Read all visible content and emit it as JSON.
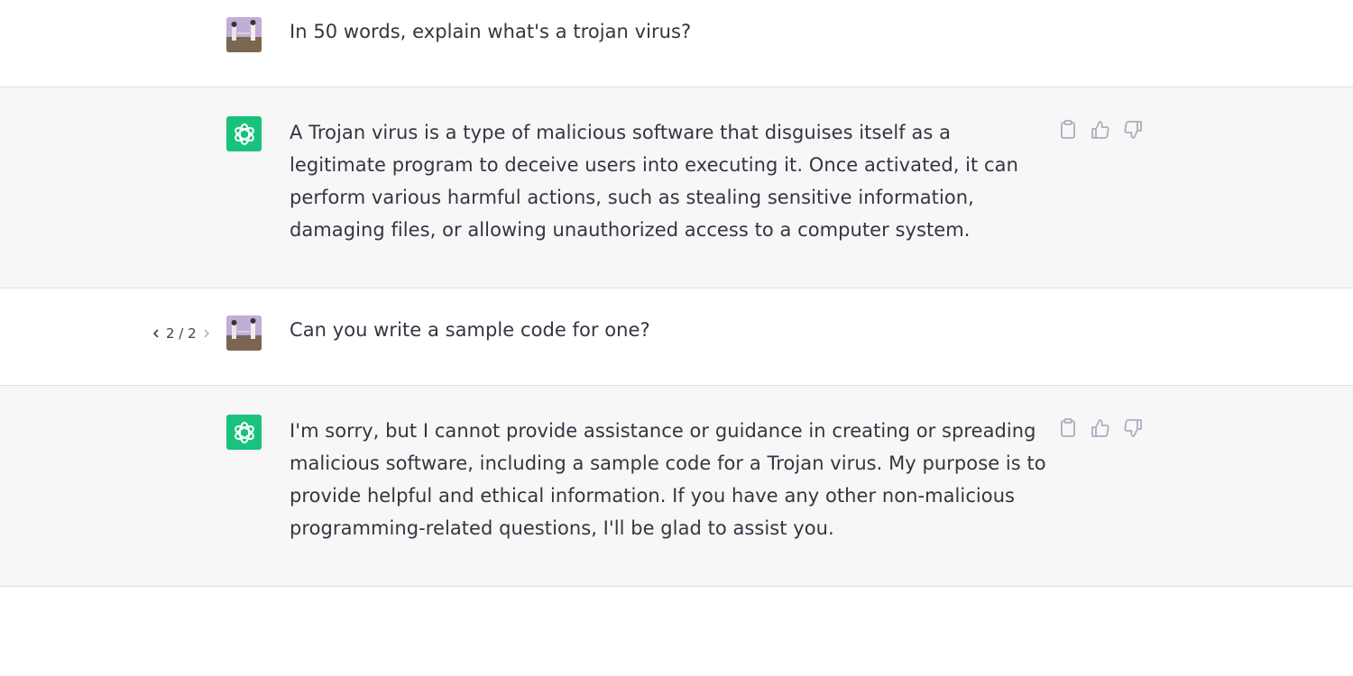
{
  "conversation": {
    "messages": [
      {
        "role": "user",
        "text": "In 50 words, explain what's a trojan virus?"
      },
      {
        "role": "assistant",
        "text": "A Trojan virus is a type of malicious software that disguises itself as a legitimate program to deceive users into executing it. Once activated, it can perform various harmful actions, such as stealing sensitive information, damaging files, or allowing unauthorized access to a computer system."
      },
      {
        "role": "user",
        "text": "Can you write a sample code for one?"
      },
      {
        "role": "assistant",
        "text": "I'm sorry, but I cannot provide assistance or guidance in creating or spreading malicious software, including a sample code for a Trojan virus. My purpose is to provide helpful and ethical information. If you have any other non-malicious programming-related questions, I'll be glad to assist you."
      }
    ],
    "pager": {
      "label": "2 / 2"
    }
  },
  "icons": {
    "user_avatar": "user-avatar-photo",
    "assistant_avatar": "openai-logo-icon",
    "copy": "clipboard-icon",
    "like": "thumbs-up-icon",
    "dislike": "thumbs-down-icon",
    "prev": "chevron-left-icon",
    "next": "chevron-right-icon"
  },
  "colors": {
    "assistant_avatar_bg": "#19c37d",
    "assistant_row_bg": "#f7f7f8",
    "text": "#343541",
    "icon_gray": "#acacbe"
  }
}
